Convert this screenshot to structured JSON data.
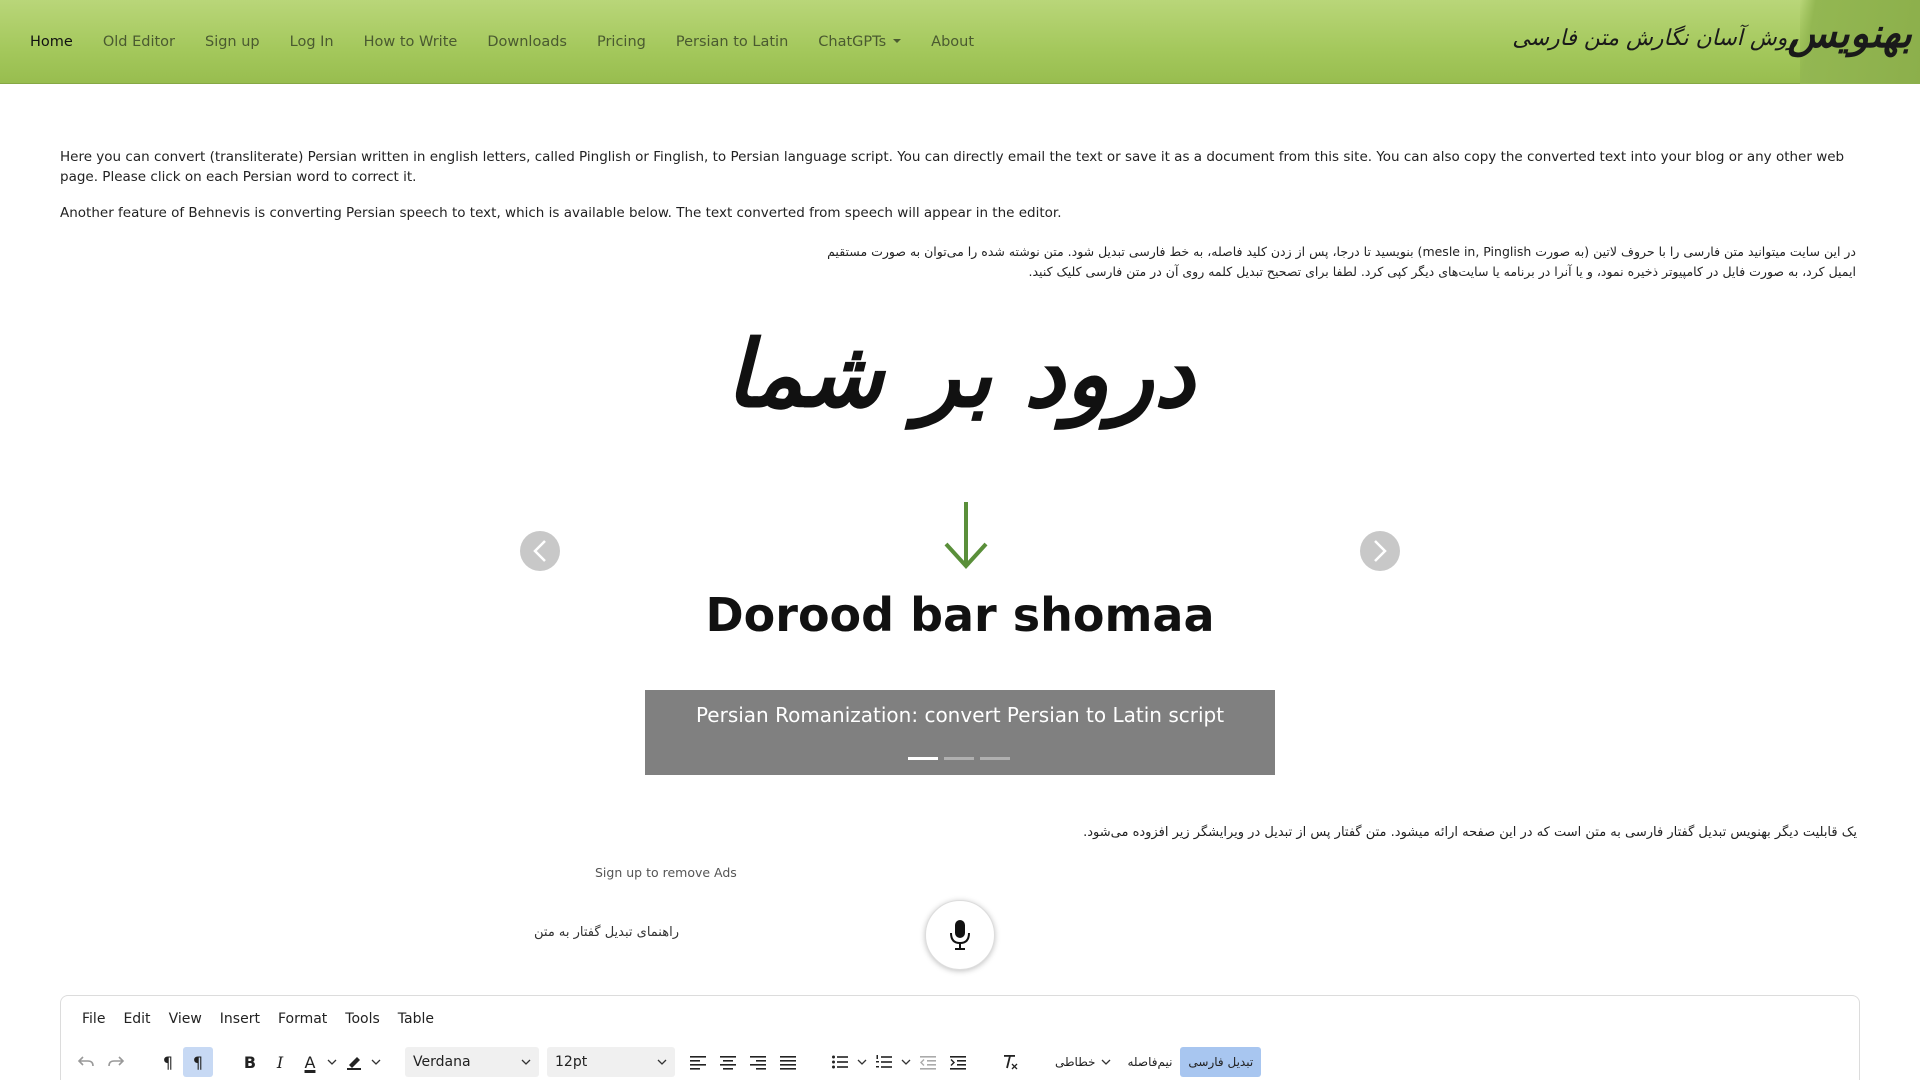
{
  "nav": {
    "items": [
      {
        "label": "Home"
      },
      {
        "label": "Old Editor"
      },
      {
        "label": "Sign up"
      },
      {
        "label": "Log In"
      },
      {
        "label": "How to Write"
      },
      {
        "label": "Downloads"
      },
      {
        "label": "Pricing"
      },
      {
        "label": "Persian to Latin"
      },
      {
        "label": "ChatGPTs"
      },
      {
        "label": "About"
      }
    ],
    "brand_tagline": "روش آسان نگارش متن فارسی",
    "brand_logo": "بهنویس"
  },
  "intro": {
    "en_paragraph_1": "Here you can convert (transliterate) Persian written in english letters, called Pinglish or Finglish, to Persian language script. You can directly email the text or save it as a document from this site. You can also copy the converted text into your blog or any other web page. Please click on each Persian word to correct it.",
    "en_paragraph_2": "Another feature of Behnevis is converting Persian speech to text, which is available below. The text converted from speech will appear in the editor.",
    "fa_paragraph": "در این سایت میتوانید متن فارسی را با حروف لاتین (به صورت mesle in, Pinglish) بنویسید تا درجا، پس از زدن کلید فاصله، به خط فارسی تبدیل شود. متن نوشته شده را می‌توان به صورت مستقیم ایمیل کرد، به صورت فایل در کامپیوتر ذخیره نمود، و یا آنرا در برنامه یا سایت‌های دیگر کپی کرد. لطفا برای تصحیح تبدیل کلمه روی آن در متن فارسی کلیک کنید."
  },
  "carousel": {
    "slide_fa_text": "درود بر شما",
    "slide_en_text": "Dorood bar shomaa",
    "caption": "Persian Romanization: convert Persian to Latin script",
    "indicator_count": 3,
    "active_index": 0
  },
  "speech": {
    "fa_text": "یک قابلیت دیگر بهنویس تبدیل گفتار فارسی به متن است که در این صفحه ارائه میشود. متن گفتار پس از تبدیل در ویرایشگر زیر افزوده می‌شود.",
    "ads_link": "Sign up to remove Ads",
    "guide_link": "راهنمای تبدیل گفتار به متن"
  },
  "editor": {
    "menus": [
      {
        "label": "File"
      },
      {
        "label": "Edit"
      },
      {
        "label": "View"
      },
      {
        "label": "Insert"
      },
      {
        "label": "Format"
      },
      {
        "label": "Tools"
      },
      {
        "label": "Table"
      }
    ],
    "font_family": "Verdana",
    "font_size": "12pt",
    "style_label": "خطاطی",
    "zwnj_label": "نیم‌فاصله",
    "convert_label": "تبدیل فارسی"
  },
  "colors": {
    "navbar": "#a4c85c",
    "caption_bg": "#808080",
    "arrow": "#5a8f3a",
    "toggle_on": "#a8c6f0"
  }
}
